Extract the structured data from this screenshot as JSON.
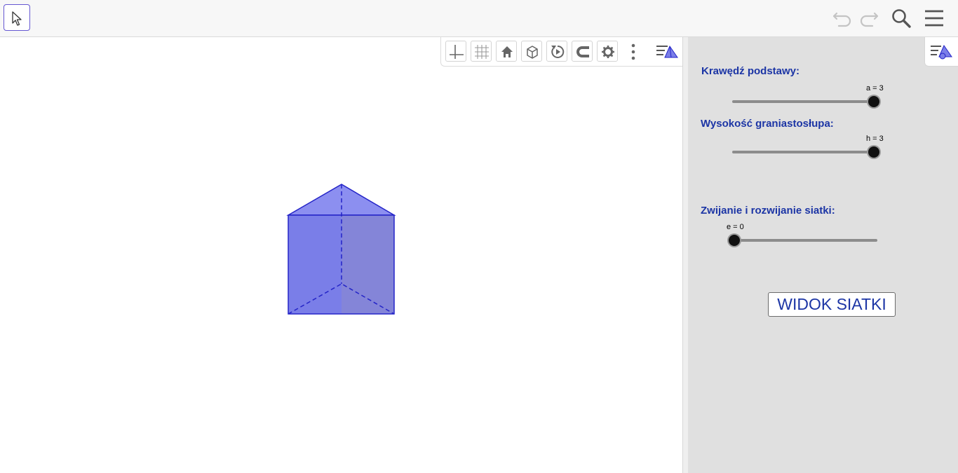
{
  "toolbar": {
    "active_tool": "move-arrow-icon",
    "right_icons": [
      "undo-icon",
      "redo-icon",
      "search-icon",
      "menu-icon"
    ]
  },
  "graphics_toolbar": {
    "buttons": [
      "axes-icon",
      "grid-icon",
      "home-icon",
      "view-cube-icon",
      "rotate-view-icon",
      "point-capture-icon",
      "settings-gear-icon",
      "more-vert-icon",
      "style-bar-toggle-icon"
    ]
  },
  "figure": {
    "shape": "triangular prism",
    "fill_color": "#7a7ee8",
    "edge_color": "#2424c8"
  },
  "sliders": [
    {
      "caption": "Krawędź podstawy:",
      "label": "a = 3",
      "value": 3,
      "fraction": 1.0
    },
    {
      "caption": "Wysokość graniastosłupa:",
      "label": "h = 3",
      "value": 3,
      "fraction": 1.0
    },
    {
      "caption": "Zwijanie i rozwijanie siatki:",
      "label": "e = 0",
      "value": 0,
      "fraction": 0.0
    }
  ],
  "net_button": {
    "label": "WIDOK SIATKI"
  },
  "colors": {
    "caption": "#1c35a5",
    "accent": "#6557d2",
    "panel_bg": "#e0e0e0"
  }
}
